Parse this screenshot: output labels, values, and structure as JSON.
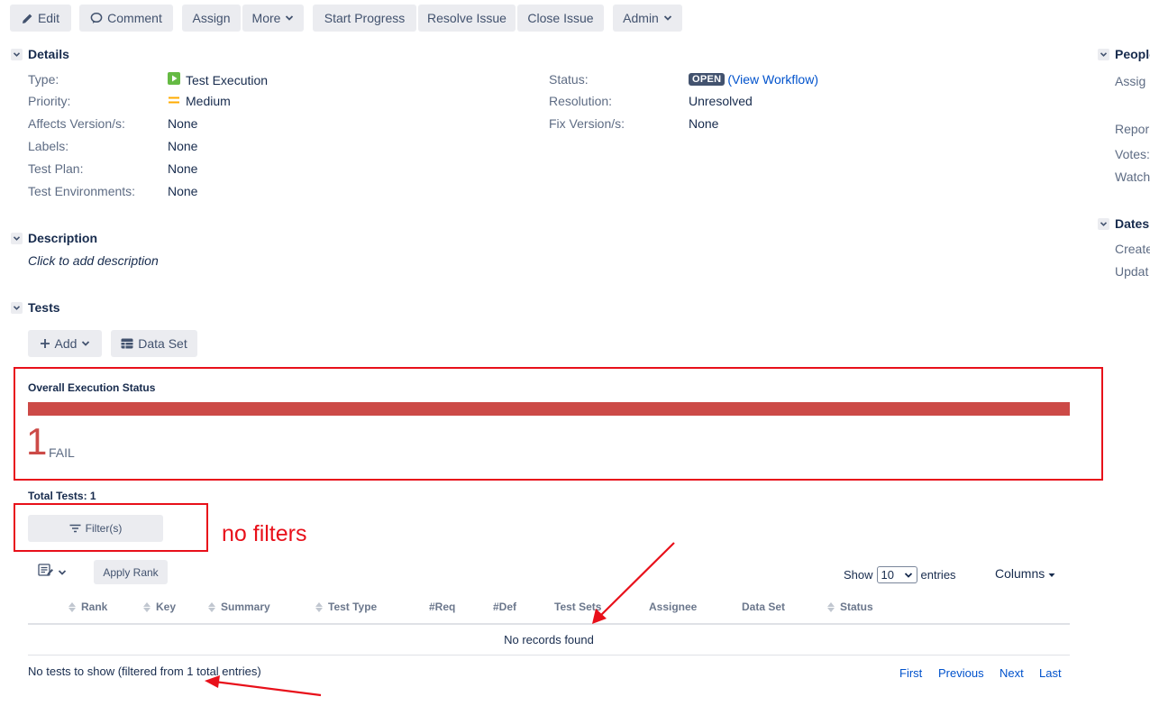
{
  "toolbar": {
    "edit": "Edit",
    "comment": "Comment",
    "assign": "Assign",
    "more": "More",
    "start_progress": "Start Progress",
    "resolve_issue": "Resolve Issue",
    "close_issue": "Close Issue",
    "admin": "Admin"
  },
  "details": {
    "title": "Details",
    "left": [
      {
        "label": "Type:",
        "value": "Test Execution",
        "icon": "test-execution-icon"
      },
      {
        "label": "Priority:",
        "value": "Medium",
        "icon": "priority-medium-icon"
      },
      {
        "label": "Affects Version/s:",
        "value": "None"
      },
      {
        "label": "Labels:",
        "value": "None"
      },
      {
        "label": "Test Plan:",
        "value": "None"
      },
      {
        "label": "Test Environments:",
        "value": "None"
      }
    ],
    "status_label": "Status:",
    "status_value": "OPEN",
    "view_workflow": "(View Workflow)",
    "resolution_label": "Resolution:",
    "resolution_value": "Unresolved",
    "fix_version_label": "Fix Version/s:",
    "fix_version_value": "None"
  },
  "people": {
    "title": "People",
    "assignee": "Assig",
    "reporter": "Repor",
    "votes": "Votes:",
    "watchers": "Watch"
  },
  "dates": {
    "title": "Dates",
    "created": "Create",
    "updated": "Updat"
  },
  "description": {
    "title": "Description",
    "placeholder": "Click to add description"
  },
  "tests": {
    "title": "Tests",
    "add": "Add",
    "data_set": "Data Set",
    "overall_title": "Overall Execution Status",
    "fail_count": "1",
    "fail_label": "FAIL",
    "fail_fraction": 1.0,
    "total_tests": "Total Tests: 1",
    "filter_button": "Filter(s)",
    "apply_rank": "Apply Rank",
    "show_label": "Show",
    "show_value": "10",
    "entries_label": "entries",
    "columns": "Columns",
    "headers": [
      "Rank",
      "Key",
      "Summary",
      "Test Type",
      "#Req",
      "#Def",
      "Test Sets",
      "Assignee",
      "Data Set",
      "Status"
    ],
    "no_records": "No records found",
    "info": "No tests to show (filtered from 1 total entries)",
    "pager": {
      "first": "First",
      "previous": "Previous",
      "next": "Next",
      "last": "Last"
    }
  },
  "annotation": {
    "note": "no filters",
    "color": "#e8101a"
  },
  "colors": {
    "fail": "#cc4a47",
    "link": "#0052cc",
    "button_bg": "#ebecf0"
  }
}
